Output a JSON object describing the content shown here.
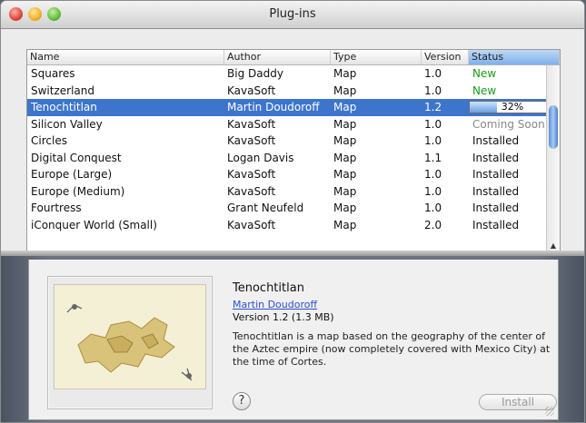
{
  "window": {
    "title": "Plug-ins"
  },
  "table": {
    "columns": [
      "Name",
      "Author",
      "Type",
      "Version",
      "Status"
    ],
    "rows": [
      {
        "name": "Squares",
        "author": "Big Daddy",
        "type": "Map",
        "version": "1.0",
        "status": "New",
        "status_kind": "new"
      },
      {
        "name": "Switzerland",
        "author": "KavaSoft",
        "type": "Map",
        "version": "1.0",
        "status": "New",
        "status_kind": "new"
      },
      {
        "name": "Tenochtitlan",
        "author": "Martin Doudoroff",
        "type": "Map",
        "version": "1.2",
        "status": "32%",
        "status_kind": "progress",
        "progress": 0.32,
        "selected": true
      },
      {
        "name": "Silicon Valley",
        "author": "KavaSoft",
        "type": "Map",
        "version": "1.0",
        "status": "Coming Soon",
        "status_kind": "soon"
      },
      {
        "name": "Circles",
        "author": "KavaSoft",
        "type": "Map",
        "version": "1.0",
        "status": "Installed",
        "status_kind": "installed"
      },
      {
        "name": "Digital Conquest",
        "author": "Logan Davis",
        "type": "Map",
        "version": "1.1",
        "status": "Installed",
        "status_kind": "installed"
      },
      {
        "name": "Europe (Large)",
        "author": "KavaSoft",
        "type": "Map",
        "version": "1.0",
        "status": "Installed",
        "status_kind": "installed"
      },
      {
        "name": "Europe (Medium)",
        "author": "KavaSoft",
        "type": "Map",
        "version": "1.0",
        "status": "Installed",
        "status_kind": "installed"
      },
      {
        "name": "Fourtress",
        "author": "Grant Neufeld",
        "type": "Map",
        "version": "1.0",
        "status": "Installed",
        "status_kind": "installed"
      },
      {
        "name": "iConquer World (Small)",
        "author": "KavaSoft",
        "type": "Map",
        "version": "2.0",
        "status": "Installed",
        "status_kind": "installed"
      }
    ]
  },
  "detail": {
    "name": "Tenochtitlan",
    "author": "Martin Doudoroff",
    "version": "Version 1.2 (1.3 MB)",
    "description": "Tenochtitlan is a map based on the geography of the center of the Aztec empire (now completely covered with Mexico City) at the time of Cortes.",
    "help_label": "?",
    "install_label": "Install"
  },
  "colors": {
    "selection": "#3d75cc",
    "status_new": "#1a9a1a",
    "status_soon": "#888888",
    "link": "#2b4fd1"
  }
}
